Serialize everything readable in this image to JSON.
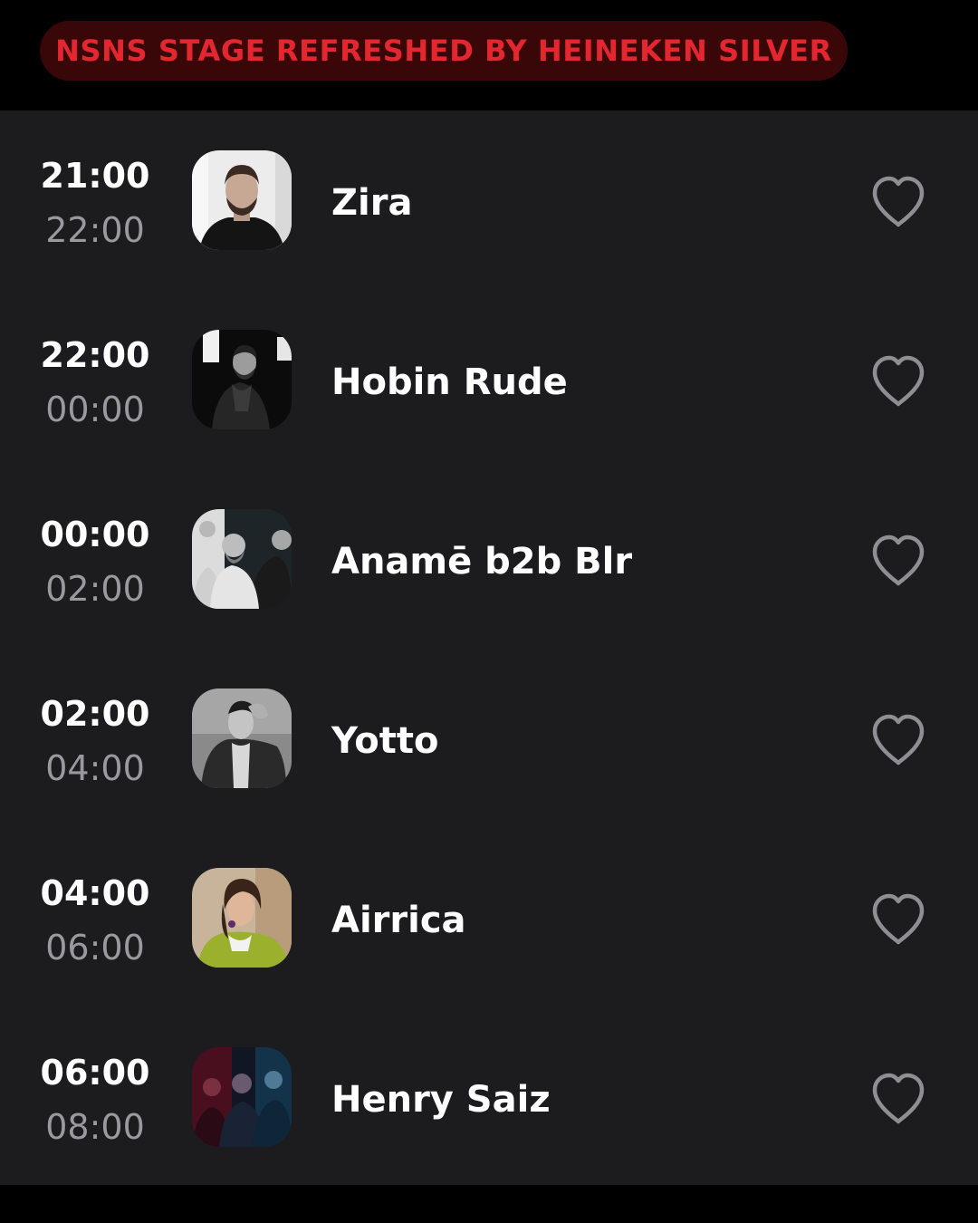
{
  "stage": {
    "name": "NSNS STAGE REFRESHED BY HEINEKEN SILVER",
    "accent_color": "#e3262f",
    "pill_color": "#3a0709"
  },
  "theme": {
    "background": "#1c1c1e",
    "start_time_color": "#ffffff",
    "end_time_color": "#9a9a9e",
    "heart_color": "#8e8e93"
  },
  "schedule": [
    {
      "start": "21:00",
      "end": "22:00",
      "artist": "Zira",
      "photo": "portrait of a bearded man in black shirt on light background",
      "favorite_icon": "heart-outline-icon"
    },
    {
      "start": "22:00",
      "end": "00:00",
      "artist": "Hobin Rude",
      "photo": "black and white portrait of a man in coat",
      "favorite_icon": "heart-outline-icon"
    },
    {
      "start": "00:00",
      "end": "02:00",
      "artist": "Anamē b2b Blr",
      "photo": "group photo of three men",
      "favorite_icon": "heart-outline-icon"
    },
    {
      "start": "02:00",
      "end": "04:00",
      "artist": "Yotto",
      "photo": "black and white portrait of a man with hand in hair",
      "favorite_icon": "heart-outline-icon"
    },
    {
      "start": "04:00",
      "end": "06:00",
      "artist": "Airrica",
      "photo": "color portrait of a woman in green jacket",
      "favorite_icon": "heart-outline-icon"
    },
    {
      "start": "06:00",
      "end": "08:00",
      "artist": "Henry Saiz",
      "photo": "group of musicians in red and blue light",
      "favorite_icon": "heart-outline-icon"
    }
  ]
}
